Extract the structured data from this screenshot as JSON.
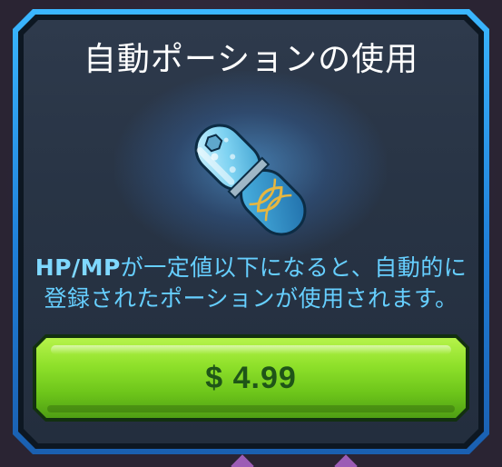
{
  "dialog": {
    "title": "自動ポーションの使用",
    "description_line1_strong": "HP/MP",
    "description_line1_rest": "が一定値以下になると、自動的に",
    "description_line2": "登録されたポーションが使用されます。",
    "item_icon": "capsule-potion-icon"
  },
  "purchase": {
    "price_label": "$ 4.99"
  },
  "colors": {
    "frame_accent": "#3ab6ff",
    "description_text": "#66cfff",
    "button_green": "#8ee02a",
    "price_text": "#1f5518"
  }
}
